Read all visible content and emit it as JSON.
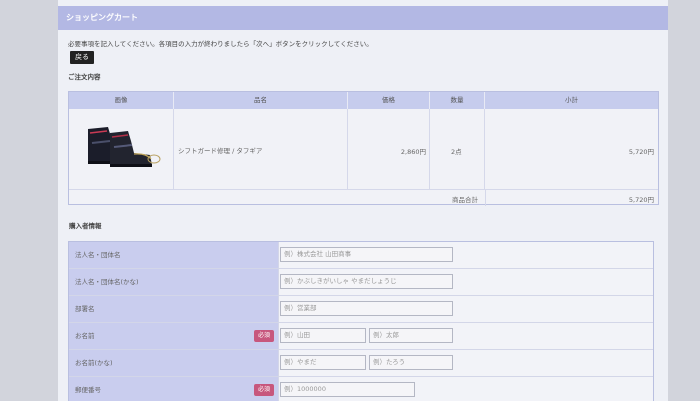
{
  "header": {
    "title": "ショッピングカート"
  },
  "instruction": "必要事項を記入してください。各項目の入力が終わりましたら「次へ」ボタンをクリックしてください。",
  "back_button": "戻る",
  "order": {
    "section_title": "ご注文内容",
    "columns": [
      "画像",
      "品名",
      "価格",
      "数量",
      "小計"
    ],
    "item": {
      "name": "シフトガード修理 / タフギア",
      "price": "2,860円",
      "quantity": "2点",
      "subtotal": "5,720円"
    },
    "total_label": "商品合計",
    "total_value": "5,720円"
  },
  "buyer": {
    "section_title": "購入者情報",
    "required_label": "必須",
    "fields": [
      {
        "label": "法人名・団体名",
        "placeholder": "例）株式会社 山田商事"
      },
      {
        "label": "法人名・団体名(かな)",
        "placeholder": "例）かぶしきがいしゃ やまだしょうじ"
      },
      {
        "label": "部署名",
        "placeholder": "例）営業部"
      },
      {
        "label": "お名前",
        "placeholder_last": "例）山田",
        "placeholder_first": "例）太郎"
      },
      {
        "label": "お名前(かな)",
        "placeholder_last": "例）やまだ",
        "placeholder_first": "例）たろう"
      },
      {
        "label": "郵便番号",
        "placeholder": "例）1000000"
      }
    ]
  },
  "colors": {
    "header_bg": "#b3b8e4",
    "label_bg": "#c9cdee",
    "required_badge": "#c7577d",
    "back_button": "#222222"
  },
  "icons": {
    "product_image": "boot-image"
  }
}
